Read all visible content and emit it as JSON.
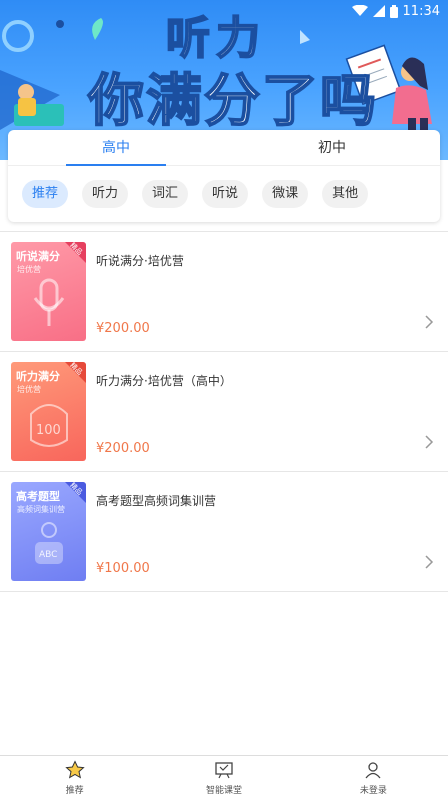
{
  "status_bar": {
    "time": "11:34"
  },
  "banner": {
    "headline_top": "听力",
    "headline_bottom": "你满分了吗"
  },
  "level_tabs": [
    {
      "label": "高中",
      "active": true
    },
    {
      "label": "初中",
      "active": false
    }
  ],
  "categories": [
    {
      "label": "推荐",
      "active": true
    },
    {
      "label": "听力",
      "active": false
    },
    {
      "label": "词汇",
      "active": false
    },
    {
      "label": "听说",
      "active": false
    },
    {
      "label": "微课",
      "active": false
    },
    {
      "label": "其他",
      "active": false
    }
  ],
  "courses": [
    {
      "name": "听说满分·培优营",
      "price": "¥200.00",
      "thumb_title": "听说满分",
      "thumb_sub": "培优营",
      "corner": "精品"
    },
    {
      "name": "听力满分·培优营（高中）",
      "price": "¥200.00",
      "thumb_title": "听力满分",
      "thumb_sub": "培优营",
      "corner": "精品"
    },
    {
      "name": "高考题型高频词集训营",
      "price": "¥100.00",
      "thumb_title": "高考题型",
      "thumb_sub": "高频词集训营",
      "corner": "精品"
    }
  ],
  "bottom_nav": [
    {
      "label": "推荐",
      "icon": "star-icon",
      "active": true
    },
    {
      "label": "智能课堂",
      "icon": "classroom-icon",
      "active": false
    },
    {
      "label": "未登录",
      "icon": "user-icon",
      "active": false
    }
  ],
  "colors": {
    "accent": "#2a7ff0",
    "price": "#f0774a",
    "banner": "#4aa3ff"
  }
}
